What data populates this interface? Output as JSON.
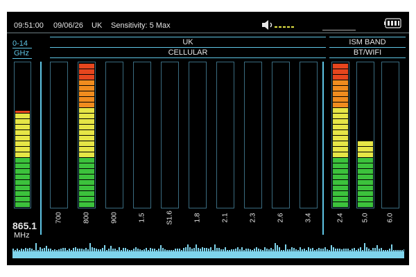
{
  "header": {
    "time": "09:51:00",
    "date": "09/06/26",
    "region": "UK",
    "sensitivity": "Sensitivity: 5 Max"
  },
  "icons": {
    "speaker": "speaker-icon",
    "battery": "battery-icon"
  },
  "colors": {
    "accent": "#5fc6e6",
    "bar_border": "#3a6c80",
    "green": "#3cc23c",
    "yellow": "#e6e646",
    "orange": "#f08c1e",
    "red": "#e6461e"
  },
  "wideband": {
    "range_line1": "0-14",
    "range_line2": "GHz",
    "level": 0.64,
    "freq_value": "865.1",
    "freq_unit": "MHz"
  },
  "cellular": {
    "title_line1": "UK",
    "title_line2": "CELLULAR",
    "bands": [
      {
        "label": "700",
        "level": 0
      },
      {
        "label": "800",
        "level": 1.0
      },
      {
        "label": "900",
        "level": 0
      },
      {
        "label": "1.5",
        "level": 0
      },
      {
        "label": "S1.6",
        "level": 0
      },
      {
        "label": "1.8",
        "level": 0
      },
      {
        "label": "2.1",
        "level": 0
      },
      {
        "label": "2.3",
        "level": 0
      },
      {
        "label": "2.6",
        "level": 0
      },
      {
        "label": "3.4",
        "level": 0
      }
    ]
  },
  "ism": {
    "title_line1": "ISM BAND",
    "title_line2": "BT/WIFI",
    "bands": [
      {
        "label": "2.4",
        "level": 1.0
      },
      {
        "label": "5.0",
        "level": 0.46
      },
      {
        "label": "6.0",
        "level": 0
      }
    ]
  }
}
